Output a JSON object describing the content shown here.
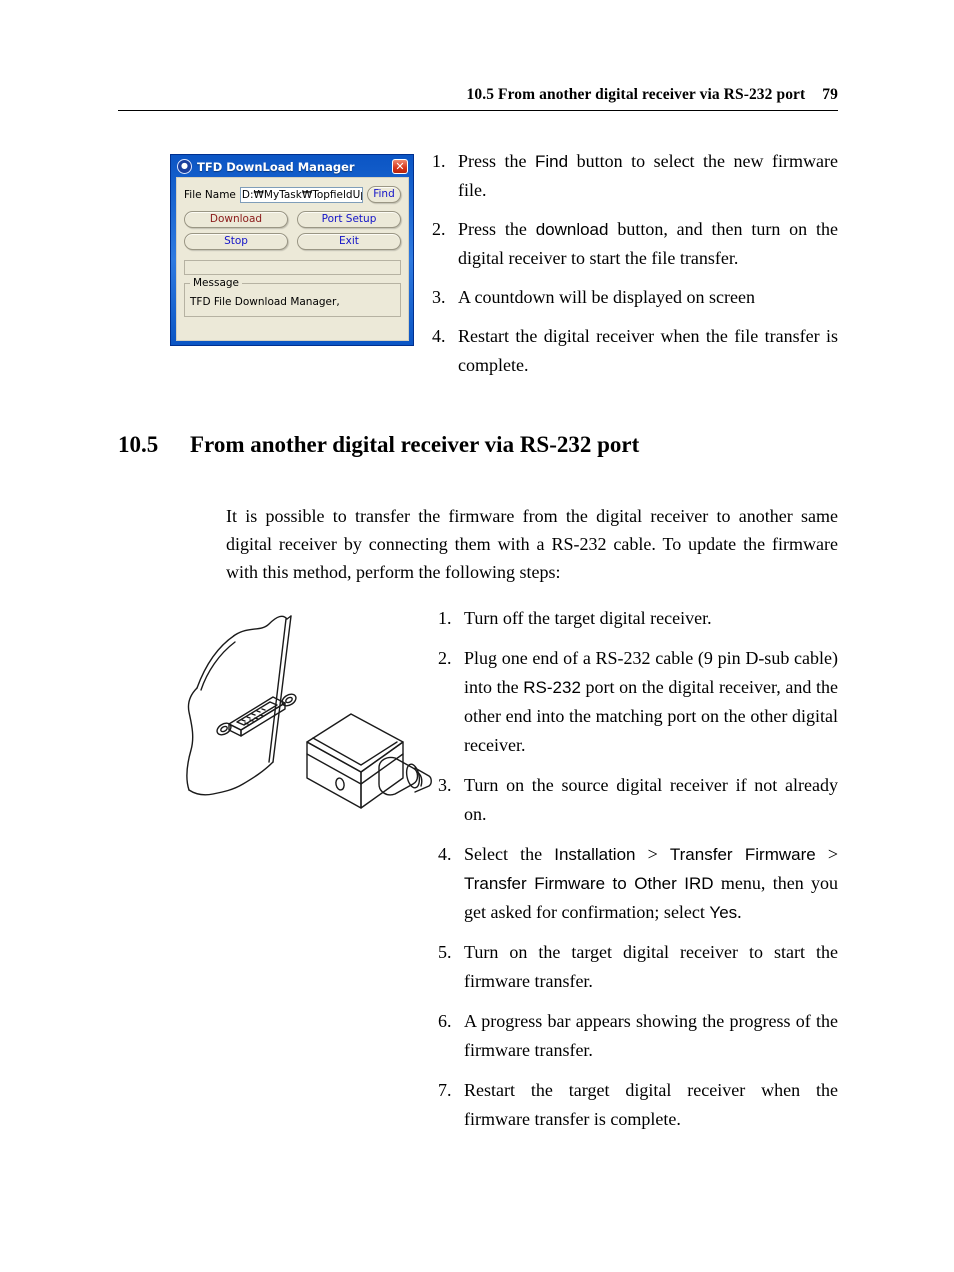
{
  "header": {
    "title": "10.5 From another digital receiver via RS-232 port",
    "page_number": "79"
  },
  "dialog": {
    "title": "TFD DownLoad Manager",
    "icon": "app-icon",
    "close_label": "✕",
    "file_name_label": "File Name",
    "file_name_value": "D:₩MyTask₩TopfieldUp",
    "find_label": "Find",
    "download_label": "Download",
    "port_setup_label": "Port Setup",
    "stop_label": "Stop",
    "exit_label": "Exit",
    "message_group_label": "Message",
    "message_text": "TFD File Download Manager,",
    "download_color": "#8b1a1a",
    "button_text_color": "#1414c8",
    "titlebar_color": "#0b55c4",
    "face_color": "#ece9d8"
  },
  "top_steps": [
    {
      "number": "1.",
      "parts": [
        {
          "text": "Press the ",
          "style": "serif"
        },
        {
          "text": "Find",
          "style": "ui"
        },
        {
          "text": " button to select the new firmware file.",
          "style": "serif"
        }
      ]
    },
    {
      "number": "2.",
      "parts": [
        {
          "text": "Press the ",
          "style": "serif"
        },
        {
          "text": "download",
          "style": "ui"
        },
        {
          "text": " button, and then turn on the digital receiver to start the file transfer.",
          "style": "serif"
        }
      ]
    },
    {
      "number": "3.",
      "parts": [
        {
          "text": "A countdown will be displayed on screen",
          "style": "serif"
        }
      ]
    },
    {
      "number": "4.",
      "parts": [
        {
          "text": "Restart the digital receiver when the file transfer is complete.",
          "style": "serif"
        }
      ]
    }
  ],
  "section": {
    "number": "10.5",
    "title": "From another digital receiver via RS-232 port"
  },
  "intro_paragraph": "It is possible to transfer the firmware from the digital receiver to another same digital receiver by connecting them with a RS-232 cable. To update the firmware with this method, perform the following steps:",
  "figure": {
    "caption": "",
    "description": "line-art illustration of a 9-pin D-sub RS-232 port on a receiver panel and a matching D-sub connector plug"
  },
  "bottom_steps": [
    {
      "number": "1.",
      "parts": [
        {
          "text": "Turn off the target digital receiver.",
          "style": "serif"
        }
      ]
    },
    {
      "number": "2.",
      "parts": [
        {
          "text": "Plug one end of a RS-232 cable (9 pin D-sub cable) into the ",
          "style": "serif"
        },
        {
          "text": "RS-232",
          "style": "ui"
        },
        {
          "text": " port on the digital receiver, and the other end into the matching port on the other digital receiver.",
          "style": "serif"
        }
      ]
    },
    {
      "number": "3.",
      "parts": [
        {
          "text": "Turn on the source digital receiver if not already on.",
          "style": "serif"
        }
      ]
    },
    {
      "number": "4.",
      "parts": [
        {
          "text": "Select the ",
          "style": "serif"
        },
        {
          "text": "Installation",
          "style": "ui"
        },
        {
          "text": " > ",
          "style": "serif"
        },
        {
          "text": "Transfer Firmware",
          "style": "ui"
        },
        {
          "text": " > ",
          "style": "serif"
        },
        {
          "text": "Transfer Firmware to Other IRD",
          "style": "ui"
        },
        {
          "text": " menu, then you get asked for confirmation; select ",
          "style": "serif"
        },
        {
          "text": "Yes",
          "style": "ui"
        },
        {
          "text": ".",
          "style": "serif"
        }
      ]
    },
    {
      "number": "5.",
      "parts": [
        {
          "text": "Turn on the target digital receiver to start the firmware transfer.",
          "style": "serif"
        }
      ]
    },
    {
      "number": "6.",
      "parts": [
        {
          "text": "A progress bar appears showing the progress of the firmware transfer.",
          "style": "serif"
        }
      ]
    },
    {
      "number": "7.",
      "parts": [
        {
          "text": "Restart the target digital receiver when the firmware transfer is complete.",
          "style": "serif"
        }
      ]
    }
  ]
}
